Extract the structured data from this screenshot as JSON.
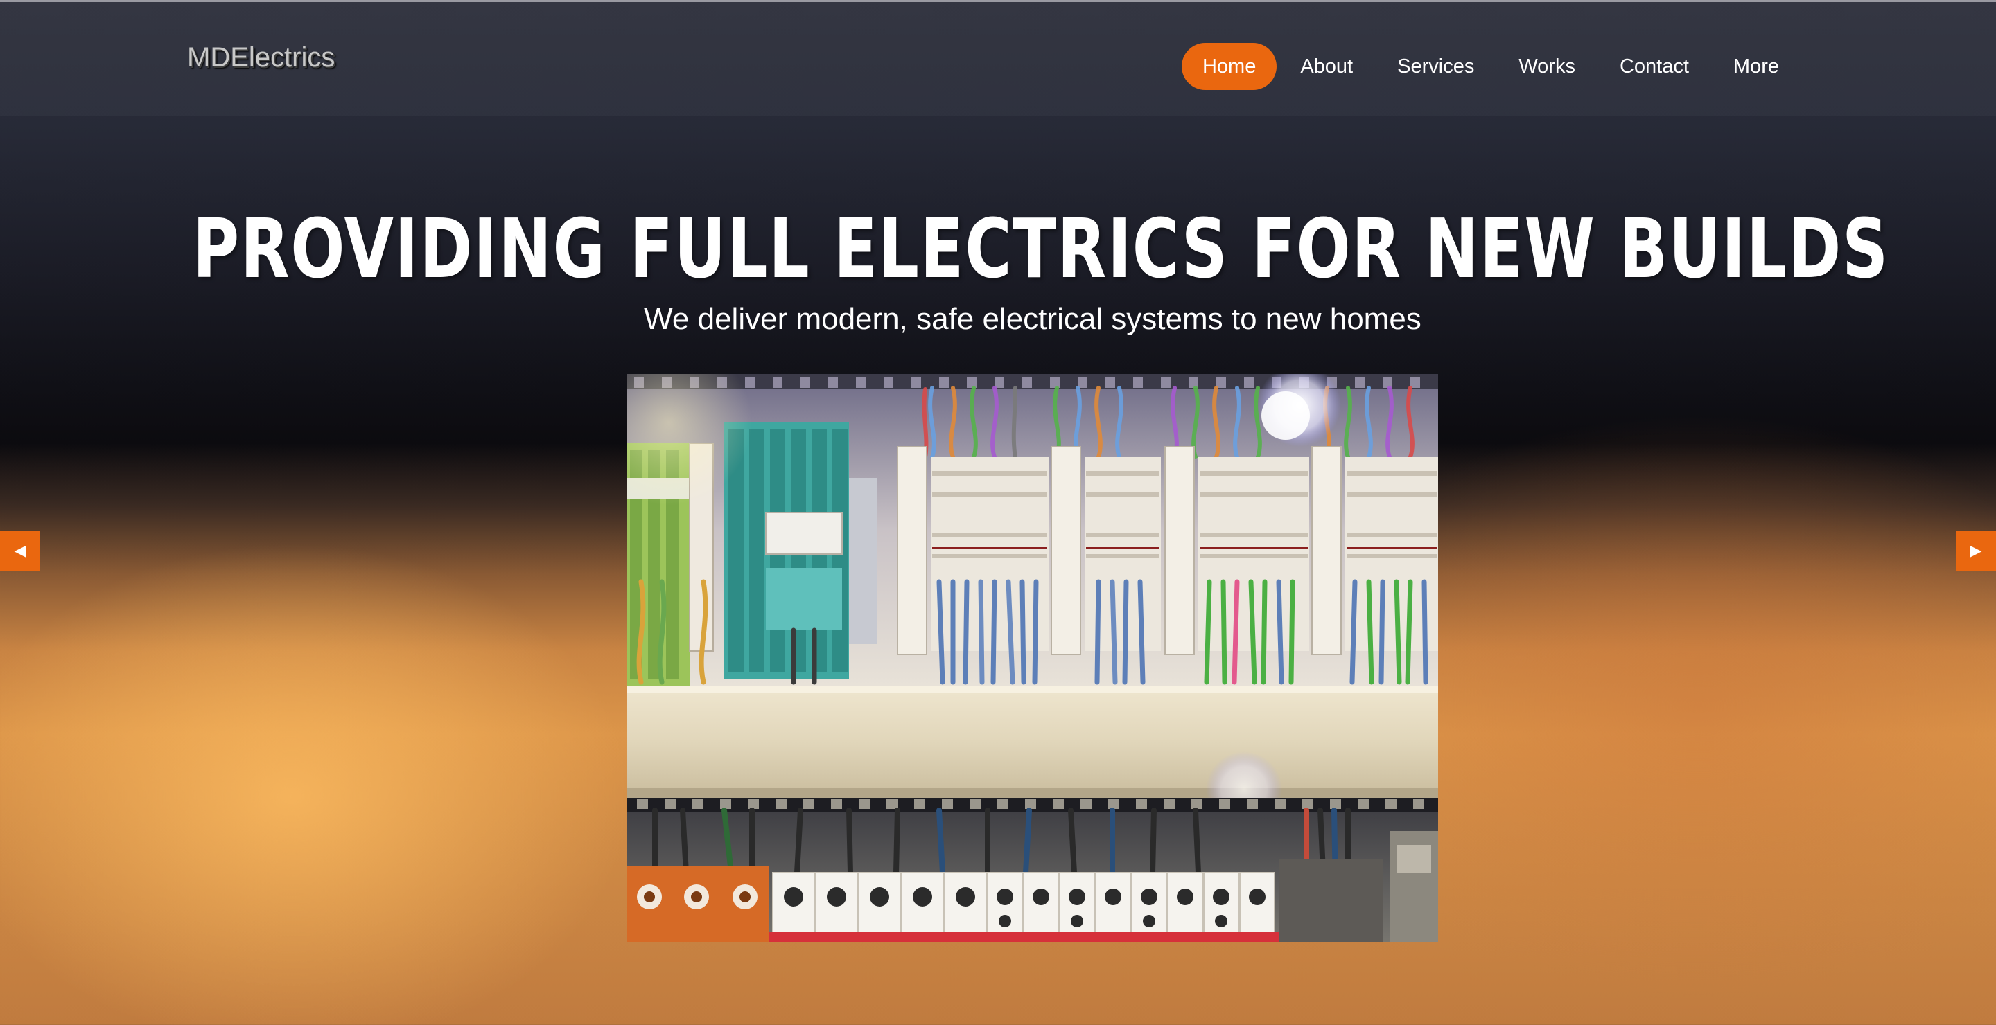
{
  "brand": {
    "logo_text": "MDElectrics"
  },
  "nav": {
    "items": [
      {
        "label": "Home",
        "active": true
      },
      {
        "label": "About",
        "active": false
      },
      {
        "label": "Services",
        "active": false
      },
      {
        "label": "Works",
        "active": false
      },
      {
        "label": "Contact",
        "active": false
      },
      {
        "label": "More",
        "active": false
      }
    ]
  },
  "hero": {
    "title": "PROVIDING FULL ELECTRICS FOR NEW BUILDS",
    "subtitle": "We deliver modern, safe electrical systems to new homes"
  },
  "slider": {
    "prev_icon": "triangle-left-icon",
    "next_icon": "triangle-right-icon",
    "prev_glyph": "◀",
    "next_glyph": "▶"
  },
  "colors": {
    "accent": "#ea670f",
    "nav_text": "#ffffff",
    "logo_text": "#c8c8c8"
  }
}
